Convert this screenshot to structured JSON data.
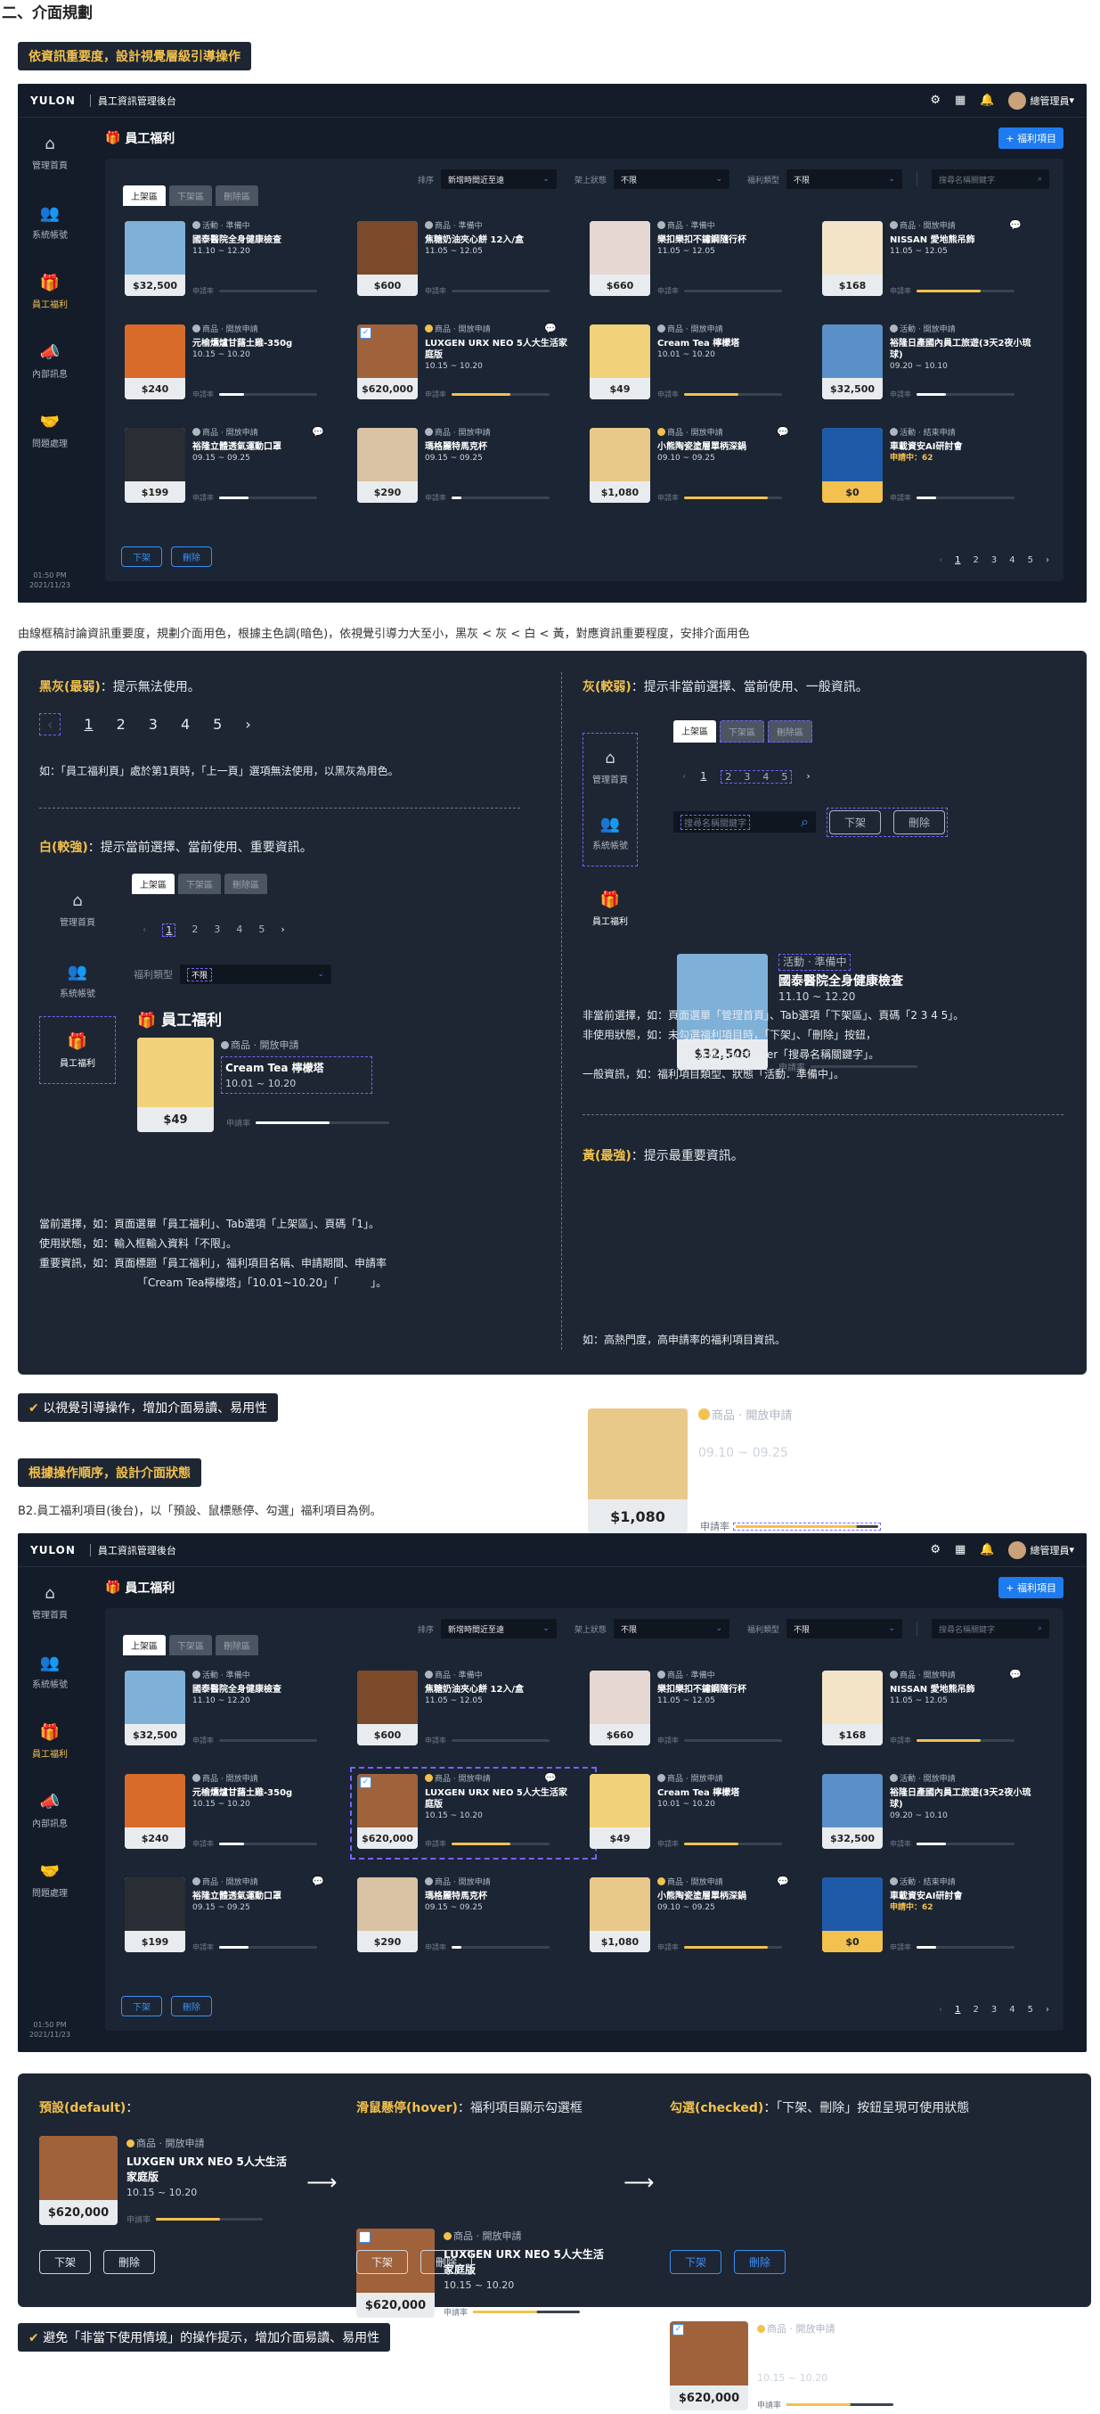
{
  "page_title": "二、介面規劃",
  "section1_tag": "依資訊重要度，設計視覺層級引導操作",
  "app": {
    "logo": "YULON",
    "system_name": "員工資訊管理後台",
    "user": "總管理員",
    "nav": [
      {
        "label": "管理首頁",
        "icon": "home-icon"
      },
      {
        "label": "系統帳號",
        "icon": "users-icon"
      },
      {
        "label": "員工福利",
        "icon": "gift-icon"
      },
      {
        "label": "內部訊息",
        "icon": "megaphone-icon"
      },
      {
        "label": "問題處理",
        "icon": "handshake-icon"
      }
    ],
    "time": "01:50 PM",
    "date": "2021/11/23",
    "page_heading": "員工福利",
    "add_button": "+ 福利項目",
    "filters": {
      "sort_label": "排序",
      "sort_value": "新增時間近至遠",
      "status_label": "架上狀態",
      "status_value": "不限",
      "type_label": "福利類型",
      "type_value": "不限",
      "search_placeholder": "搜尋名稱關鍵字"
    },
    "tabs": [
      "上架區",
      "下架區",
      "刪除區"
    ],
    "apply_label": "申請率",
    "items": [
      {
        "status": "活動 · 準備中",
        "title": "國泰醫院全身健康檢查",
        "date": "11.10 ~ 12.20",
        "price": "$32,500",
        "img": "#7fb0d8",
        "rate": 0,
        "gold": false,
        "chat": false,
        "emoji": false
      },
      {
        "status": "商品 · 準備中",
        "title": "焦糖奶油夾心餅 12入/盒",
        "date": "11.05 ~ 12.05",
        "price": "$600",
        "img": "#7a4a2a",
        "rate": 0,
        "gold": false,
        "chat": false,
        "emoji": false
      },
      {
        "status": "商品 · 準備中",
        "title": "樂扣樂扣不鏽鋼隨行杯",
        "date": "11.05 ~ 12.05",
        "price": "$660",
        "img": "#e7d7d2",
        "rate": 0,
        "gold": false,
        "chat": false,
        "emoji": false
      },
      {
        "status": "商品 · 開放申請",
        "title": "NISSAN 愛地熊吊飾",
        "date": "11.05 ~ 12.05",
        "price": "$168",
        "img": "#f3e4c8",
        "rate": 0.65,
        "gold": false,
        "chat": true,
        "emoji": false
      },
      {
        "status": "商品 · 開放申請",
        "title": "元榆燻爐甘藷土雞-350g",
        "date": "10.15 ~ 10.20",
        "price": "$240",
        "img": "#d86a2a",
        "rate": 0.25,
        "gold": false,
        "chat": false,
        "emoji": false
      },
      {
        "status": "商品 · 開放申請",
        "title": "LUXGEN URX NEO 5人大生活家庭版",
        "date": "10.15 ~ 10.20",
        "price": "$620,000",
        "img": "#a0623a",
        "rate": 0.6,
        "gold": false,
        "chat": true,
        "emoji": true,
        "checked": true
      },
      {
        "status": "商品 · 開放申請",
        "title": "Cream Tea 檸檬塔",
        "date": "10.01 ~ 10.20",
        "price": "$49",
        "img": "#f1d27a",
        "rate": 0.55,
        "gold": false,
        "chat": false,
        "emoji": false
      },
      {
        "status": "活動 · 開放申請",
        "title": "裕隆日產國內員工旅遊(3天2夜小琉球)",
        "date": "09.20 ~ 10.10",
        "price": "$32,500",
        "img": "#5a8fc8",
        "rate": 0.3,
        "gold": false,
        "chat": false,
        "emoji": false
      },
      {
        "status": "商品 · 開放申請",
        "title": "裕隆立體透氣運動口罩",
        "date": "09.15 ~ 09.25",
        "price": "$199",
        "img": "#2a2d33",
        "rate": 0.3,
        "gold": false,
        "chat": true,
        "emoji": false
      },
      {
        "status": "商品 · 開放申請",
        "title": "瑪格麗特馬克杯",
        "date": "09.15 ~ 09.25",
        "price": "$290",
        "img": "#d9c3a4",
        "rate": 0.1,
        "gold": false,
        "chat": false,
        "emoji": false
      },
      {
        "status": "商品 · 開放申請",
        "title": "小熊陶瓷塗層單柄深鍋",
        "date": "09.10 ~ 09.25",
        "price": "$1,080",
        "img": "#e9c98a",
        "rate": 0.85,
        "gold": false,
        "chat": true,
        "emoji": true
      },
      {
        "status": "活動 · 結束申請",
        "title": "車載資安AI研討會",
        "date": "申請中：62",
        "price": "$0",
        "img": "#1f5aa8",
        "rate": 0.2,
        "gold": true,
        "chat": false,
        "emoji": false
      }
    ],
    "bottom_buttons": [
      "下架",
      "刪除"
    ],
    "pages": [
      "1",
      "2",
      "3",
      "4",
      "5"
    ]
  },
  "explain_note": "由線框稿討論資訊重要度，規劃介面用色，根據主色調(暗色)，依視覺引導力大至小，黑灰 < 灰 < 白 < 黃，對應資訊重要程度，安排介面用色",
  "hierarchy": {
    "dark_gray": {
      "title": "黑灰(最弱)",
      "desc": "：提示無法使用。",
      "example": "如：「員工福利頁」處於第1頁時，「上一頁」選項無法使用，以黑灰為用色。"
    },
    "gray": {
      "title": "灰(較弱)",
      "desc": "：提示非當前選擇、當前使用、一般資訊。",
      "lines": [
        "非當前選擇，如：頁面選單「管理首頁」、Tab選項「下架區」、頁碼「2 3 4 5」。",
        "非使用狀態，如：未勾選福利項目時，「下架」、「刪除」按鈕，",
        "輸入框placehoder「搜尋名稱關鍵字」。",
        "一般資訊，如：福利項目類型、狀態「活動．準備中」。"
      ]
    },
    "white": {
      "title": "白(較強)",
      "desc": "：提示當前選擇、當前使用、重要資訊。",
      "lines": [
        "當前選擇，如：頁面選單「員工福利」、Tab選項「上架區」、頁碼「1」。",
        "使用狀態，如：輸入框輸入資料「不限」。",
        "重要資訊，如：頁面標題「員工福利」，福利項目名稱、申請期間、申請率",
        "「Cream Tea檸檬塔」「10.01~10.20」「　　　」。"
      ]
    },
    "yellow": {
      "title": "黃(最強)",
      "desc": "：提示最重要資訊。",
      "example": "如：高熱門度，高申請率的福利項目資訊。"
    }
  },
  "demo": {
    "pages": [
      "1",
      "2",
      "3",
      "4",
      "5"
    ],
    "search_placeholder": "搜尋名稱關鍵字",
    "type_label": "福利類型",
    "type_value": "不限",
    "heading": "員工福利",
    "cream": {
      "status": "商品 · 開放申請",
      "title": "Cream Tea 檸檬塔",
      "date": "10.01 ~ 10.20",
      "price": "$49"
    },
    "health": {
      "status": "活動 · 準備中",
      "title": "國泰醫院全身健康檢查",
      "date": "11.10 ~ 12.20",
      "price": "$32,500"
    },
    "pot": {
      "status": "商品 · 開放申請",
      "title": "小熊陶瓷塗層單柄深鍋",
      "date": "09.10 ~ 09.25",
      "price": "$1,080"
    }
  },
  "section1_result": "以視覺引導操作，增加介面易讀、易用性",
  "section2_tag": "根據操作順序，設計介面狀態",
  "section2_note": "B2.員工福利項目(後台)，以「預設、鼠標懸停、勾選」福利項目為例。",
  "states": [
    {
      "title": "預設(default)",
      "desc": "："
    },
    {
      "title": "滑鼠懸停(hover)",
      "desc": "：福利項目顯示勾選框"
    },
    {
      "title": "勾選(checked)",
      "desc": "：「下架、刪除」按鈕呈現可使用狀態"
    }
  ],
  "state_item": {
    "status": "商品 · 開放申請",
    "title": "LUXGEN URX NEO 5人大生活家庭版",
    "date": "10.15 ~ 10.20",
    "price": "$620,000"
  },
  "section2_result": "避免「非當下使用情境」的操作提示，增加介面易讀、易用性",
  "colors": {
    "bg": "#131c28",
    "panel": "#1b2533",
    "accent": "#f2c14e",
    "blue": "#1e7bf0"
  }
}
